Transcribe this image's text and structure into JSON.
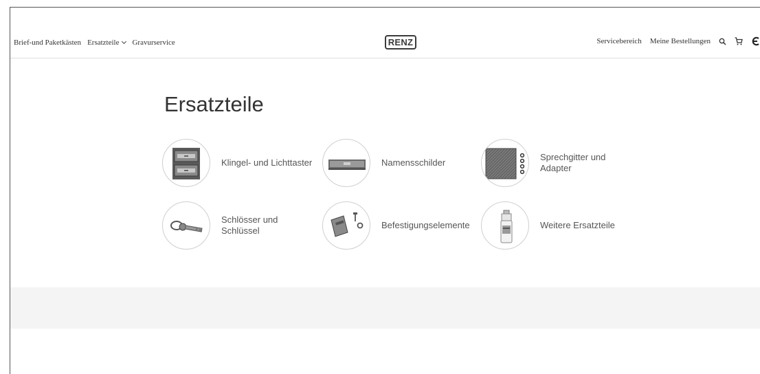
{
  "nav": {
    "left": [
      {
        "label": "Brief-und Paketkästen"
      },
      {
        "label": "Ersatzteile"
      },
      {
        "label": "Gravurservice"
      }
    ],
    "logo_text": "RENZ",
    "right": [
      {
        "label": "Servicebereich"
      },
      {
        "label": "Meine Bestellungen"
      }
    ],
    "icons": [
      "search-icon",
      "cart-icon",
      "currency-icon"
    ]
  },
  "page_title": "Ersatzteile",
  "categories": [
    {
      "label": "Klingel- und Lichttaster",
      "icon": "doorbell-panel-icon"
    },
    {
      "label": "Namensschilder",
      "icon": "name-plate-icon"
    },
    {
      "label": "Sprechgitter und Adapter",
      "icon": "speaker-grille-icon"
    },
    {
      "label": "Schlösser und Schlüssel",
      "icon": "key-icon"
    },
    {
      "label": "Befestigungselemente",
      "icon": "fastener-icon"
    },
    {
      "label": "Weitere Ersatzteile",
      "icon": "spray-bottle-icon"
    }
  ]
}
